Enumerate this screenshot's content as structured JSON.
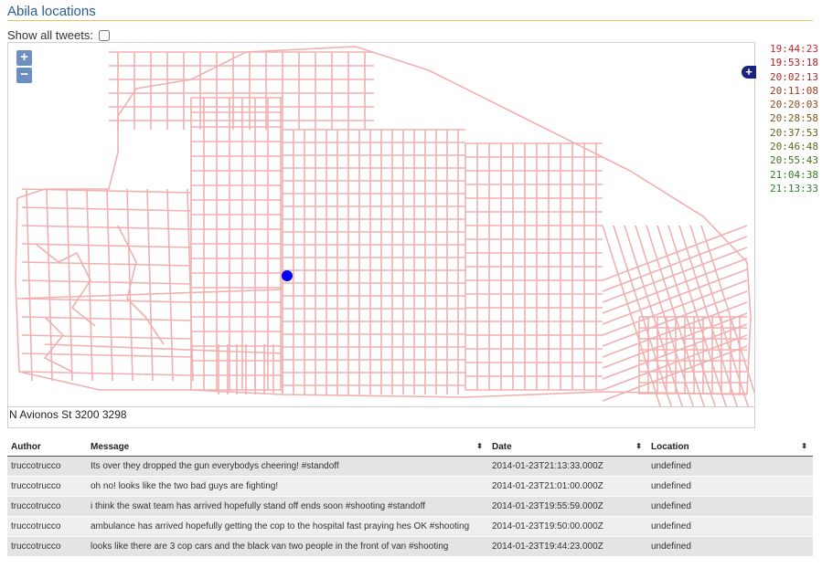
{
  "page": {
    "title": "Abila locations"
  },
  "controls": {
    "show_all_label": "Show all tweets:"
  },
  "map": {
    "zoom_in": "+",
    "zoom_out": "−",
    "layer_switcher": "+",
    "marker_color": "#0000ee",
    "street_color": "#f0b0b0",
    "location_text": "N Avionos St 3200 3298"
  },
  "timeline": [
    {
      "time": "19:44:23",
      "color": "#c62828"
    },
    {
      "time": "19:53:18",
      "color": "#b71c1c"
    },
    {
      "time": "20:02:13",
      "color": "#a52a2a"
    },
    {
      "time": "20:11:08",
      "color": "#9c3c20"
    },
    {
      "time": "20:20:03",
      "color": "#8d4a1e"
    },
    {
      "time": "20:28:58",
      "color": "#7c561c"
    },
    {
      "time": "20:37:53",
      "color": "#6b601a"
    },
    {
      "time": "20:46:48",
      "color": "#5a6a1a"
    },
    {
      "time": "20:55:43",
      "color": "#48721a"
    },
    {
      "time": "21:04:38",
      "color": "#35791c"
    },
    {
      "time": "21:13:33",
      "color": "#2e7d32"
    }
  ],
  "table": {
    "headers": {
      "author": "Author",
      "message": "Message",
      "date": "Date",
      "location": "Location"
    },
    "sort_glyph": "⬍",
    "rows": [
      {
        "author": "truccotrucco",
        "message": "Its over they dropped the gun everybodys cheering! #standoff",
        "date": "2014-01-23T21:13:33.000Z",
        "location": "undefined"
      },
      {
        "author": "truccotrucco",
        "message": "oh no! looks like the two bad guys are fighting!",
        "date": "2014-01-23T21:01:00.000Z",
        "location": "undefined"
      },
      {
        "author": "truccotrucco",
        "message": "i think the swat team has arrived hopefully stand off ends soon #shooting #standoff",
        "date": "2014-01-23T19:55:59.000Z",
        "location": "undefined"
      },
      {
        "author": "truccotrucco",
        "message": "ambulance has arrived hopefully getting the cop to the hospital fast praying hes OK #shooting",
        "date": "2014-01-23T19:50:00.000Z",
        "location": "undefined"
      },
      {
        "author": "truccotrucco",
        "message": "looks like there are 3 cop cars and the black van two people in the front of van #shooting",
        "date": "2014-01-23T19:44:23.000Z",
        "location": "undefined"
      }
    ]
  }
}
